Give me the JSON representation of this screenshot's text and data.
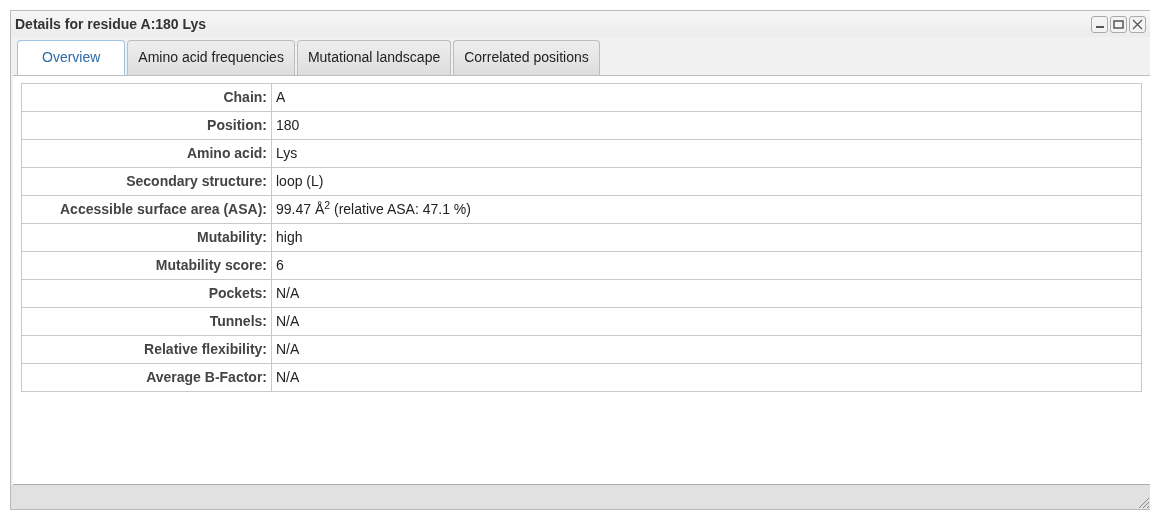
{
  "window": {
    "title": "Details for residue A:180 Lys"
  },
  "tabs": [
    {
      "label": "Overview",
      "selected": true
    },
    {
      "label": "Amino acid frequencies",
      "selected": false
    },
    {
      "label": "Mutational landscape",
      "selected": false
    },
    {
      "label": "Correlated positions",
      "selected": false
    }
  ],
  "details": [
    {
      "label": "Chain:",
      "value": "A"
    },
    {
      "label": "Position:",
      "value": "180"
    },
    {
      "label": "Amino acid:",
      "value": "Lys"
    },
    {
      "label": "Secondary structure:",
      "value": "loop (L)"
    },
    {
      "label": "Accessible surface area (ASA):",
      "value": "99.47 Å$^{2}$ (relative ASA: 47.1 %)"
    },
    {
      "label": "Mutability:",
      "value": "high"
    },
    {
      "label": "Mutability score:",
      "value": "6"
    },
    {
      "label": "Pockets:",
      "value": "N/A"
    },
    {
      "label": "Tunnels:",
      "value": "N/A"
    },
    {
      "label": "Relative flexibility:",
      "value": "N/A"
    },
    {
      "label": "Average B-Factor:",
      "value": "N/A"
    }
  ]
}
